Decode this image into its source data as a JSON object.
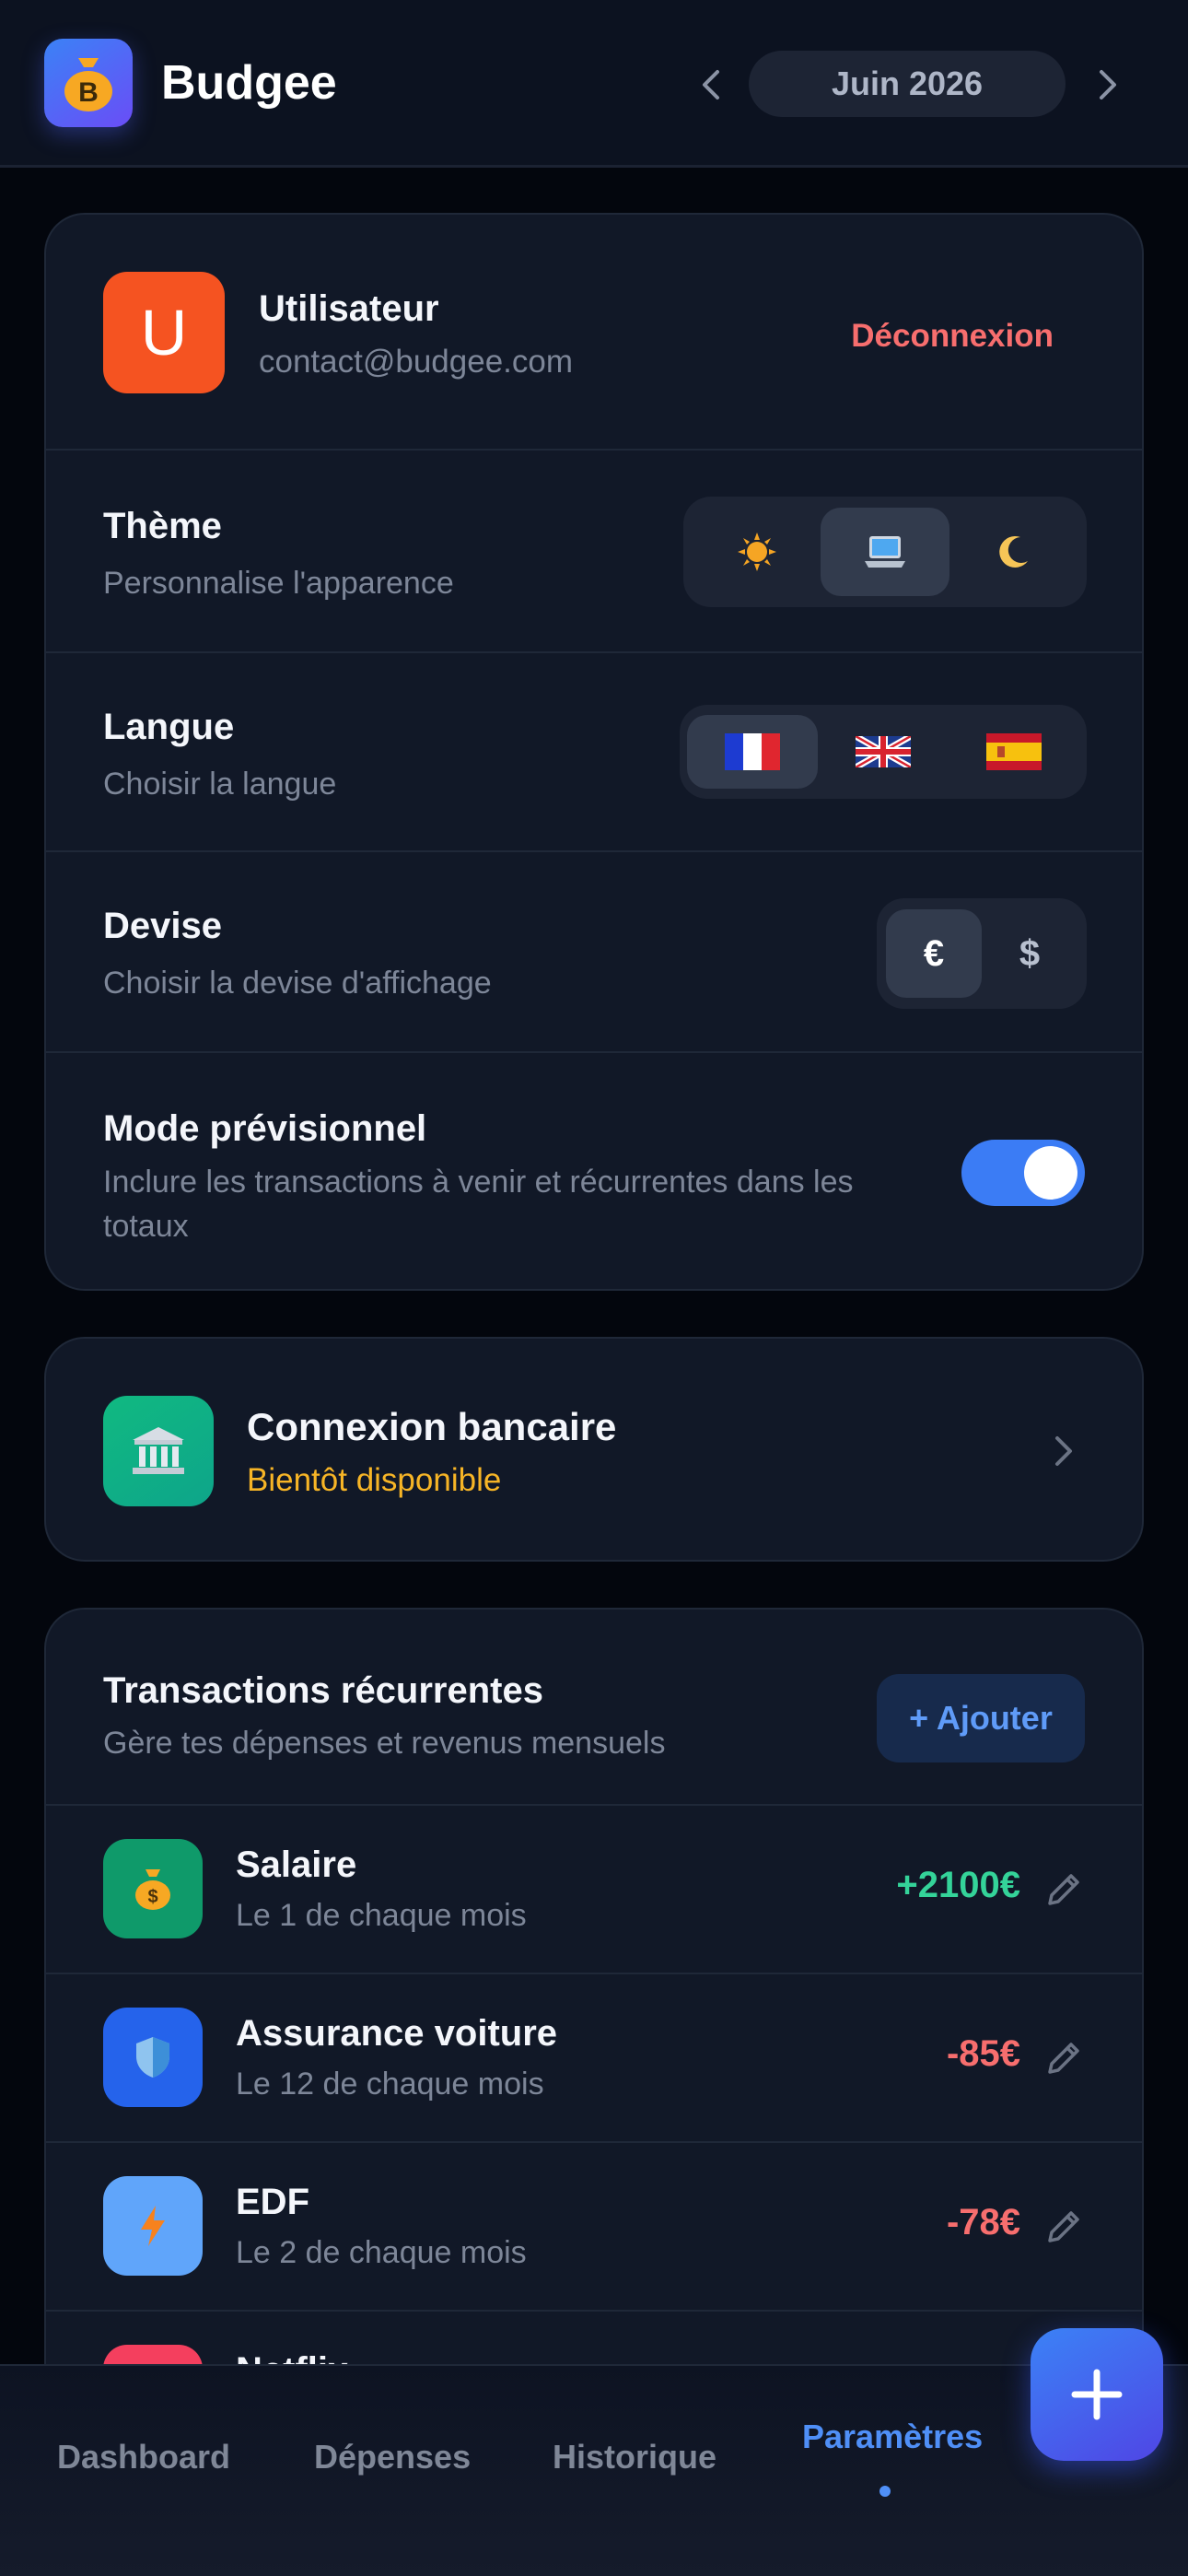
{
  "header": {
    "app_title": "Budgee",
    "logo_letter": "B",
    "month": "Juin 2026"
  },
  "account": {
    "avatar_letter": "U",
    "name": "Utilisateur",
    "email": "contact@budgee.com",
    "logout_label": "Déconnexion"
  },
  "settings": {
    "theme": {
      "title": "Thème",
      "subtitle": "Personnalise l'apparence",
      "options": [
        "sun-icon",
        "laptop-icon",
        "moon-icon"
      ],
      "selected": "laptop-icon"
    },
    "language": {
      "title": "Langue",
      "subtitle": "Choisir la langue",
      "options": [
        "flag-fr-icon",
        "flag-uk-icon",
        "flag-es-icon"
      ],
      "selected": "flag-fr-icon"
    },
    "currency": {
      "title": "Devise",
      "subtitle": "Choisir la devise d'affichage",
      "options": [
        "€",
        "$"
      ],
      "selected": "€"
    },
    "forecast": {
      "title": "Mode prévisionnel",
      "subtitle": "Inclure les transactions à venir et récurrentes dans les totaux",
      "enabled": true
    }
  },
  "bank": {
    "title": "Connexion bancaire",
    "subtitle": "Bientôt disponible",
    "icon": "bank-icon"
  },
  "recurring": {
    "title": "Transactions récurrentes",
    "subtitle": "Gère tes dépenses et revenus mensuels",
    "add_label": "+ Ajouter",
    "items": [
      {
        "name": "Salaire",
        "desc": "Le 1 de chaque mois",
        "amount": "+2100€",
        "icon": "money-bag-icon",
        "color": "#0f9a6a"
      },
      {
        "name": "Assurance voiture",
        "desc": "Le 12 de chaque mois",
        "amount": "-85€",
        "icon": "shield-icon",
        "color": "#2563eb"
      },
      {
        "name": "EDF",
        "desc": "Le 2 de chaque mois",
        "amount": "-78€",
        "icon": "lightning-icon",
        "color": "#60a5fa"
      },
      {
        "name": "Netflix",
        "desc": "",
        "amount": "",
        "icon": "",
        "color": "#f43f5e"
      }
    ]
  },
  "nav": {
    "items": [
      "Dashboard",
      "Dépenses",
      "Historique",
      "Paramètres"
    ],
    "active": "Paramètres"
  },
  "colors": {
    "accent": "#3b82f6",
    "positive": "#34d399",
    "negative": "#f76e6e",
    "warning": "#f7b526"
  }
}
